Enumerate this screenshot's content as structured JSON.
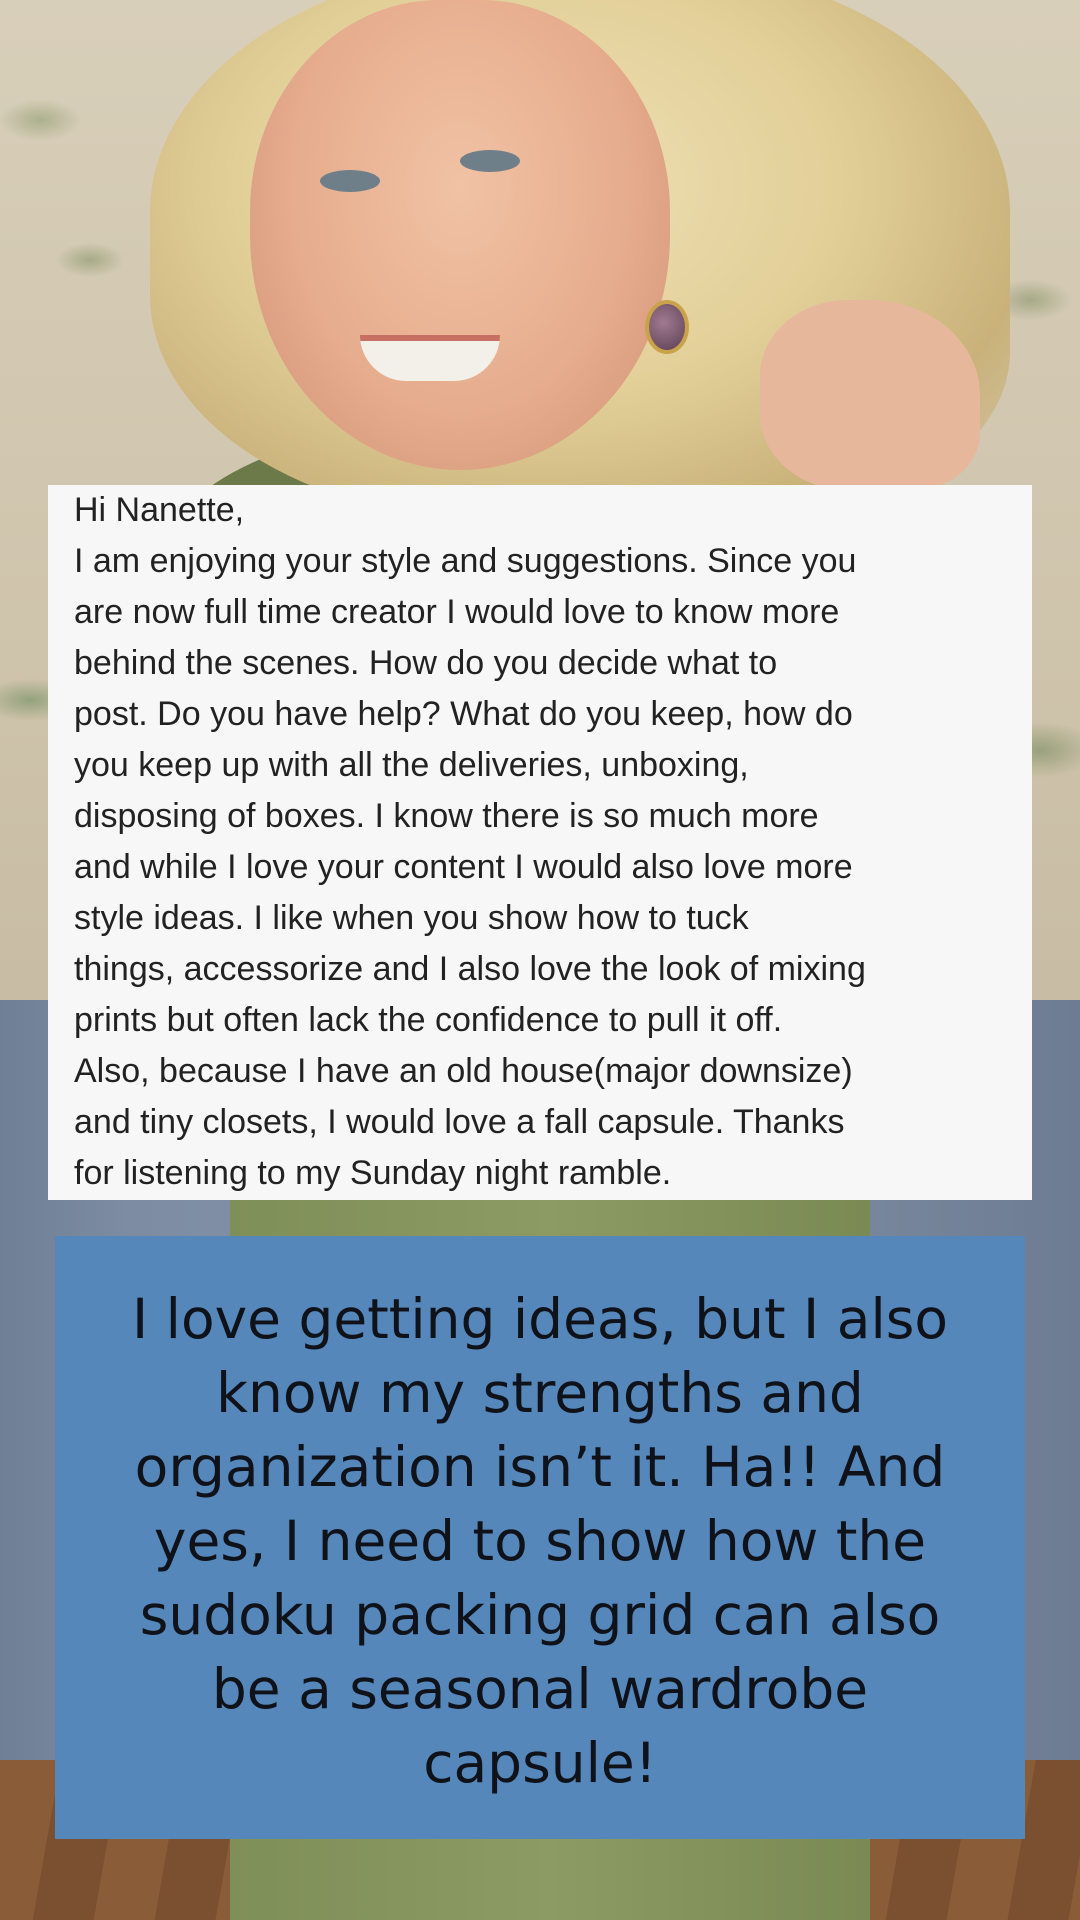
{
  "note": {
    "lines": [
      "Hi Nanette,",
      "I am enjoying your style and suggestions.  Since you",
      "are now full time creator I would love to know more",
      "behind the scenes.  How do you decide what to",
      "post. Do you have help? What do you keep, how do",
      "you keep up with all the deliveries, unboxing,",
      "disposing of boxes.  I know there is so much more",
      "and while I love your content I would also love more",
      "style ideas.  I like when you show how to tuck",
      "things, accessorize and I also love the look of mixing",
      "prints but often lack the confidence to pull it off.",
      " Also, because I have an old house(major downsize)",
      "and tiny closets, I would love a fall capsule.  Thanks",
      "for listening to my Sunday night ramble."
    ]
  },
  "reply": {
    "lines": [
      "I love getting ideas, but I also",
      "know my strengths and",
      "organization isn’t it. Ha!! And",
      "yes, I need to show how the",
      "sudoku packing grid can also",
      "be a seasonal wardrobe",
      "capsule!"
    ]
  },
  "colors": {
    "caption_background": "#5587bb",
    "note_background": "#f7f7f8"
  }
}
